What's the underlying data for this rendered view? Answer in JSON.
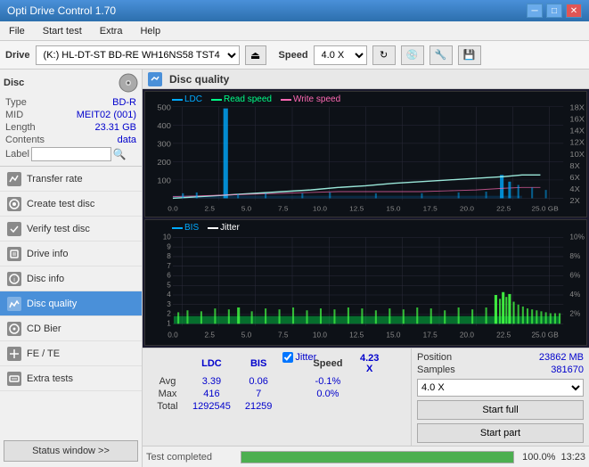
{
  "titlebar": {
    "title": "Opti Drive Control 1.70",
    "minimize": "─",
    "maximize": "□",
    "close": "✕"
  },
  "menubar": {
    "items": [
      "File",
      "Start test",
      "Extra",
      "Help"
    ]
  },
  "toolbar": {
    "drive_label": "Drive",
    "drive_value": "(K:)  HL-DT-ST BD-RE  WH16NS58 TST4",
    "speed_label": "Speed",
    "speed_value": "4.0 X"
  },
  "sidebar": {
    "disc_title": "Disc",
    "disc_fields": [
      {
        "label": "Type",
        "value": "BD-R"
      },
      {
        "label": "MID",
        "value": "MEIT02 (001)"
      },
      {
        "label": "Length",
        "value": "23.31 GB"
      },
      {
        "label": "Contents",
        "value": "data"
      },
      {
        "label": "Label",
        "value": ""
      }
    ],
    "nav_items": [
      {
        "label": "Transfer rate",
        "active": false
      },
      {
        "label": "Create test disc",
        "active": false
      },
      {
        "label": "Verify test disc",
        "active": false
      },
      {
        "label": "Drive info",
        "active": false
      },
      {
        "label": "Disc info",
        "active": false
      },
      {
        "label": "Disc quality",
        "active": true
      },
      {
        "label": "CD Bier",
        "active": false
      },
      {
        "label": "FE / TE",
        "active": false
      },
      {
        "label": "Extra tests",
        "active": false
      }
    ],
    "status_btn": "Status window >>"
  },
  "quality": {
    "title": "Disc quality",
    "legend_top": [
      "LDC",
      "Read speed",
      "Write speed"
    ],
    "legend_bottom": [
      "BIS",
      "Jitter"
    ],
    "x_labels": [
      "0.0",
      "2.5",
      "5.0",
      "7.5",
      "10.0",
      "12.5",
      "15.0",
      "17.5",
      "20.0",
      "22.5",
      "25.0 GB"
    ],
    "y_top_right": [
      "18X",
      "16X",
      "14X",
      "12X",
      "10X",
      "8X",
      "6X",
      "4X",
      "2X"
    ],
    "y_top_left": [
      "500",
      "400",
      "300",
      "200",
      "100"
    ],
    "y_bottom_left": [
      "10",
      "9",
      "8",
      "7",
      "6",
      "5",
      "4",
      "3",
      "2",
      "1"
    ],
    "y_bottom_right": [
      "10%",
      "8%",
      "6%",
      "4%",
      "2%"
    ]
  },
  "stats": {
    "columns": [
      "",
      "LDC",
      "BIS",
      "",
      "Jitter",
      "Speed",
      "4.23 X"
    ],
    "rows": [
      {
        "label": "Avg",
        "ldc": "3.39",
        "bis": "0.06",
        "jitter": "-0.1%"
      },
      {
        "label": "Max",
        "ldc": "416",
        "bis": "7",
        "jitter": "0.0%"
      },
      {
        "label": "Total",
        "ldc": "1292545",
        "bis": "21259",
        "jitter": ""
      }
    ],
    "speed_select": "4.0 X",
    "position_label": "Position",
    "position_value": "23862 MB",
    "samples_label": "Samples",
    "samples_value": "381670",
    "start_full_btn": "Start full",
    "start_part_btn": "Start part",
    "jitter_checked": true
  },
  "progress": {
    "status": "Test completed",
    "percent": 100,
    "percent_text": "100.0%",
    "time": "13:23"
  }
}
